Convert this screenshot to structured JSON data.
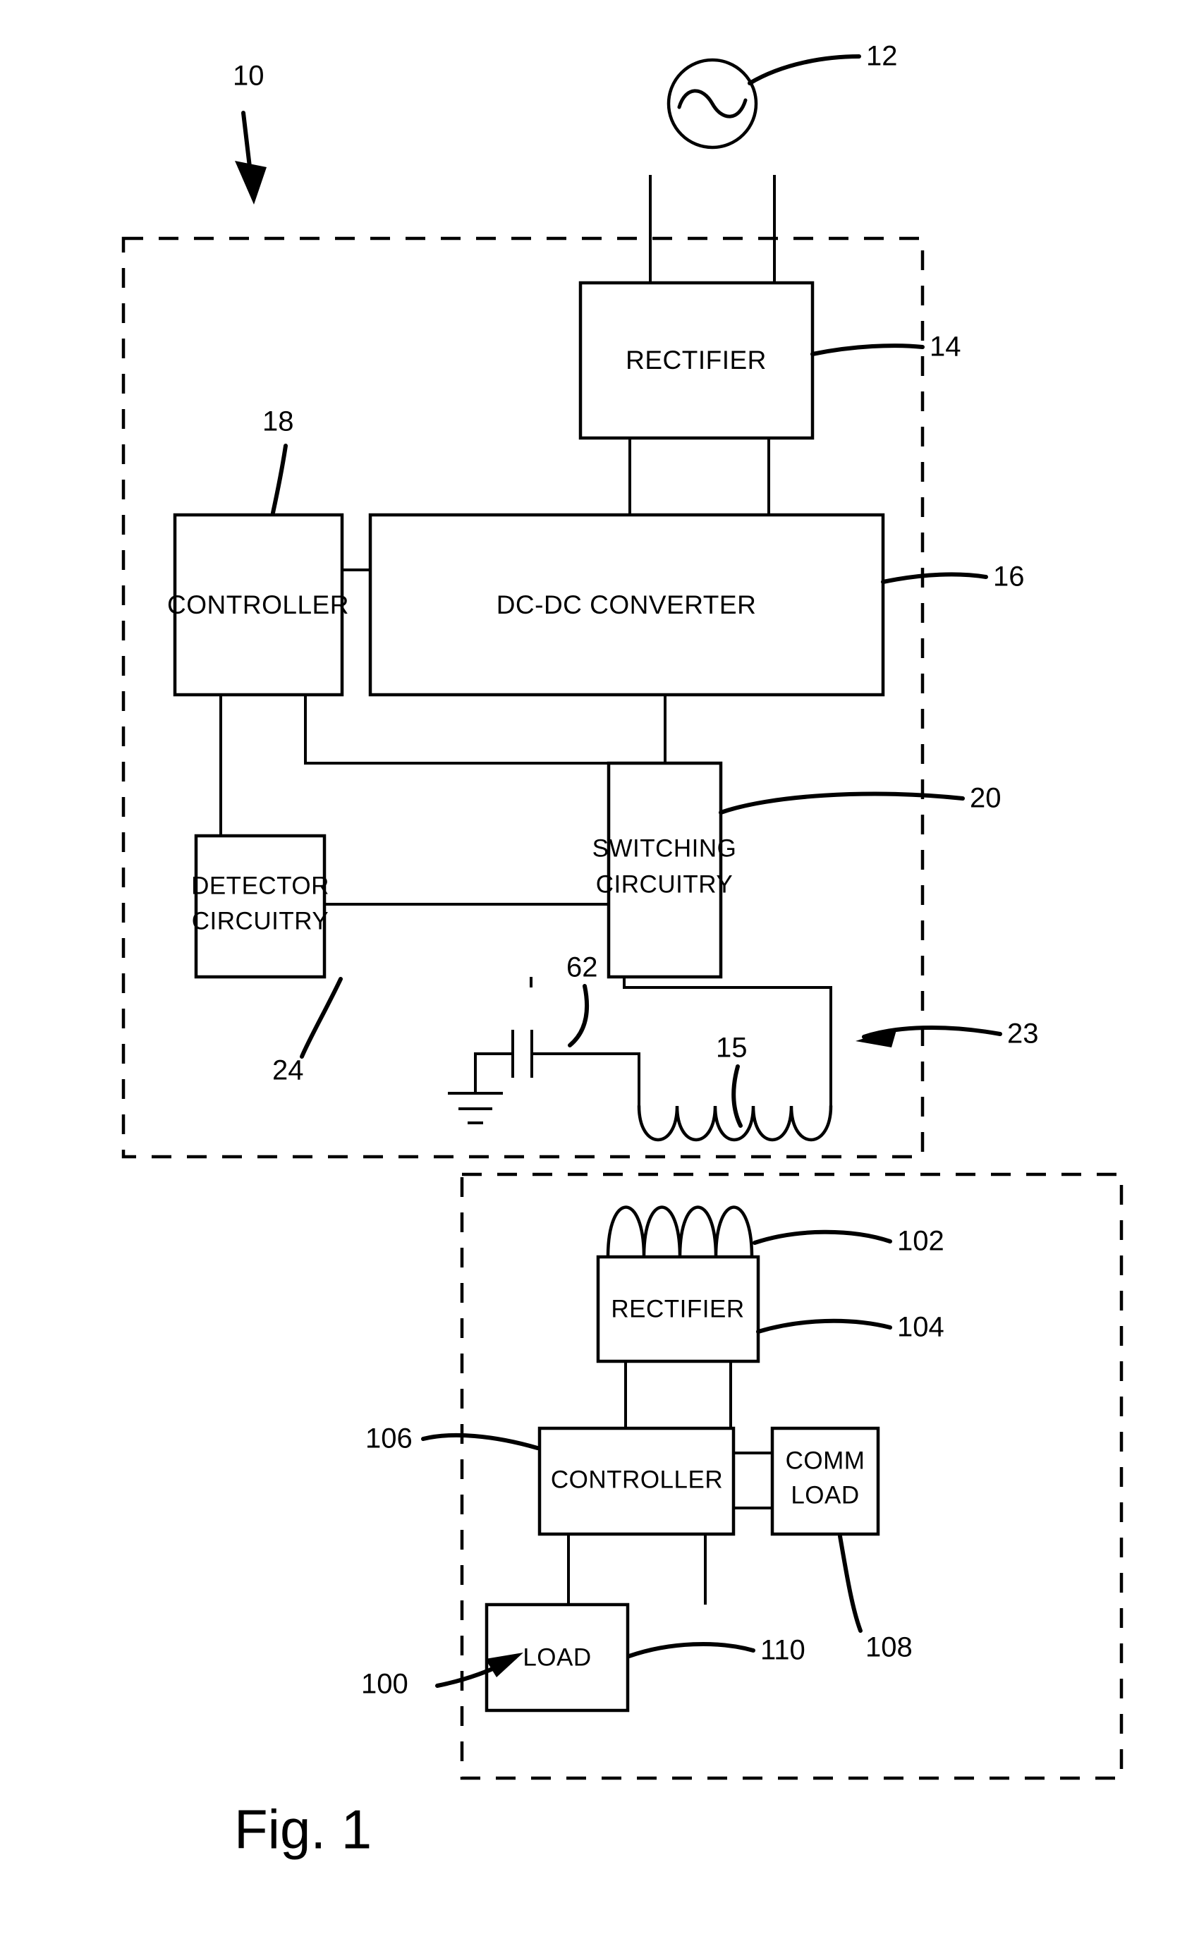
{
  "figure": {
    "caption": "Fig. 1",
    "title": "Wireless power transfer system block diagram"
  },
  "transmitter": {
    "ref": "10",
    "inner_ref": "23",
    "blocks": [
      {
        "id": "rectifier",
        "label": "RECTIFIER",
        "ref": "14"
      },
      {
        "id": "controller",
        "label": "CONTROLLER",
        "ref": "18"
      },
      {
        "id": "dcdc",
        "label": "DC-DC CONVERTER",
        "ref": "16"
      },
      {
        "id": "detector",
        "label_line1": "DETECTOR",
        "label_line2": "CIRCUITRY",
        "ref": "24"
      },
      {
        "id": "switching",
        "label_line1": "SWITCHING",
        "label_line2": "CIRCUITRY",
        "ref": "20"
      }
    ],
    "components": [
      {
        "id": "ac-source",
        "ref": "12",
        "symbol": "sine-wave-source"
      },
      {
        "id": "capacitor",
        "ref": "62",
        "symbol": "capacitor"
      },
      {
        "id": "ground",
        "ref": "",
        "symbol": "ground"
      },
      {
        "id": "transmit-coil",
        "ref": "15",
        "symbol": "inductor-coil"
      }
    ]
  },
  "receiver": {
    "ref": "100",
    "blocks": [
      {
        "id": "rx-rectifier",
        "label": "RECTIFIER",
        "ref": "104"
      },
      {
        "id": "rx-controller",
        "label": "CONTROLLER",
        "ref": "106"
      },
      {
        "id": "comm-load",
        "label_line1": "COMM",
        "label_line2": "LOAD",
        "ref": "108"
      },
      {
        "id": "load",
        "label": "LOAD",
        "ref": "110"
      }
    ],
    "components": [
      {
        "id": "receive-coil",
        "ref": "102",
        "symbol": "inductor-coil"
      }
    ]
  },
  "refs": {
    "r10": "10",
    "r12": "12",
    "r14": "14",
    "r15": "15",
    "r16": "16",
    "r18": "18",
    "r20": "20",
    "r23": "23",
    "r24": "24",
    "r62": "62",
    "r100": "100",
    "r102": "102",
    "r104": "104",
    "r106": "106",
    "r108": "108",
    "r110": "110"
  },
  "labels": {
    "rectifier": "RECTIFIER",
    "controller": "CONTROLLER",
    "dcdc_converter": "DC-DC CONVERTER",
    "detector_1": "DETECTOR",
    "detector_2": "CIRCUITRY",
    "switching_1": "SWITCHING",
    "switching_2": "CIRCUITRY",
    "rx_rectifier": "RECTIFIER",
    "rx_controller": "CONTROLLER",
    "comm_1": "COMM",
    "comm_2": "LOAD",
    "load": "LOAD"
  },
  "colors": {
    "ink": "#000000",
    "paper": "#ffffff"
  }
}
